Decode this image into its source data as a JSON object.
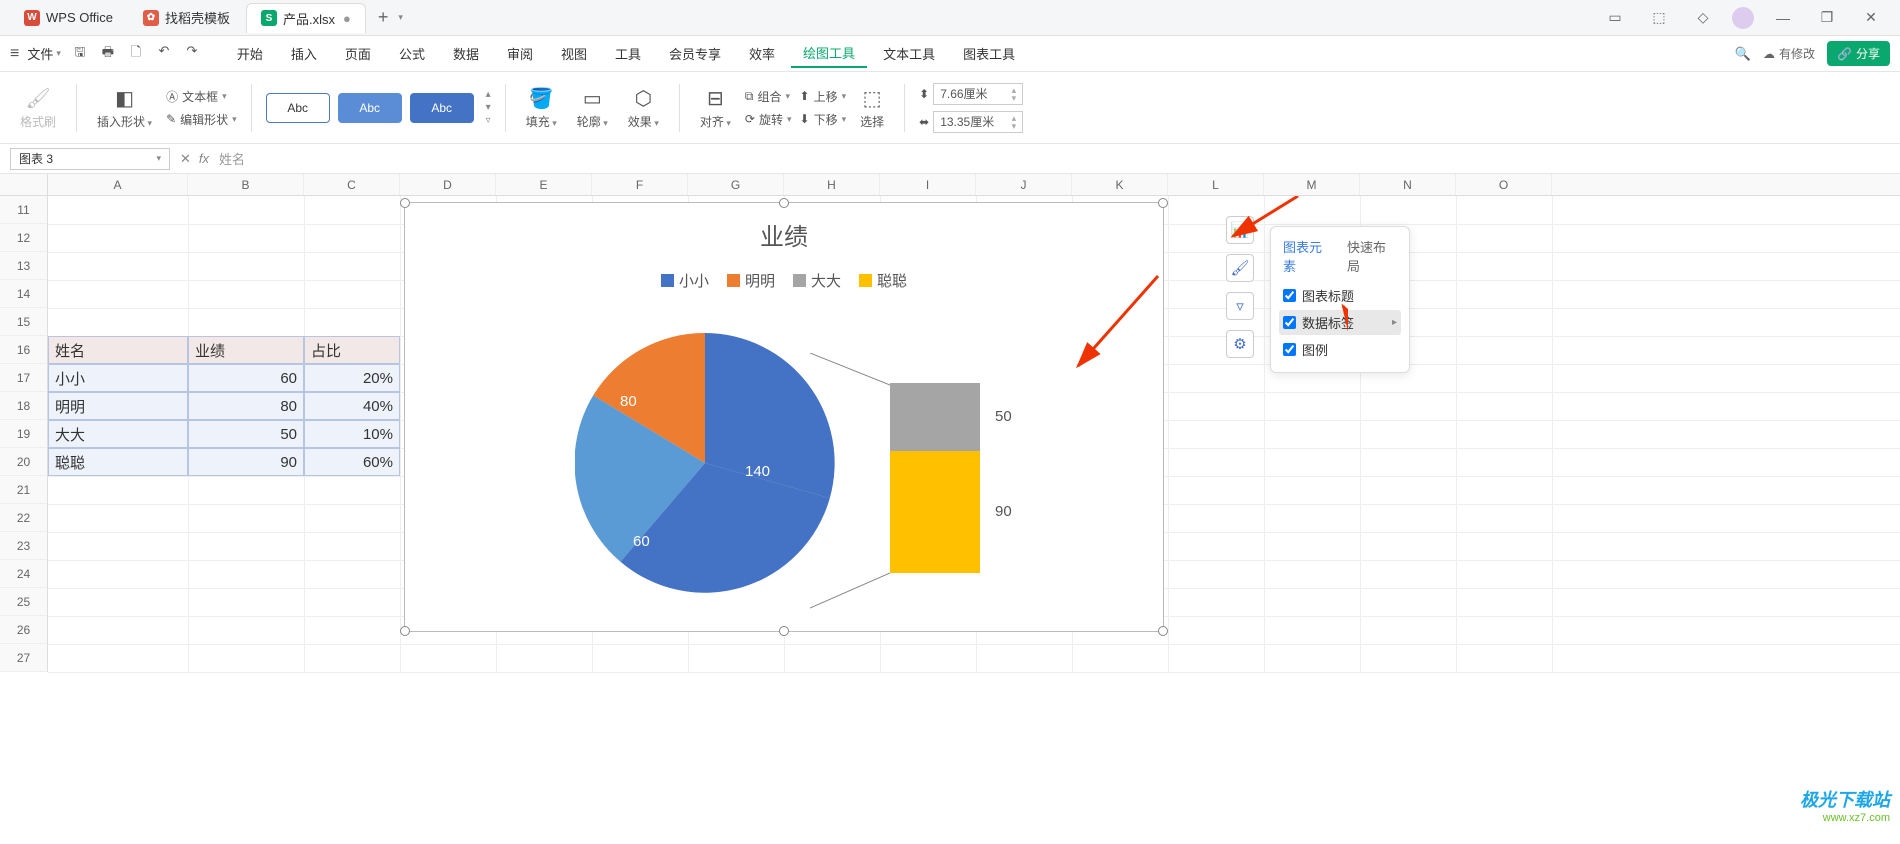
{
  "title": {
    "app": "WPS Office",
    "template": "找稻壳模板",
    "doc": "产品.xlsx"
  },
  "menu": {
    "file": "文件",
    "items": [
      "开始",
      "插入",
      "页面",
      "公式",
      "数据",
      "审阅",
      "视图",
      "工具",
      "会员专享",
      "效率",
      "绘图工具",
      "文本工具",
      "图表工具"
    ],
    "active": "绘图工具",
    "modify": "有修改",
    "share": "分享"
  },
  "ribbon": {
    "format_brush": "格式刷",
    "insert_shape": "插入形状",
    "textbox": "文本框",
    "edit_shape": "编辑形状",
    "abc": "Abc",
    "fill": "填充",
    "outline": "轮廓",
    "effect": "效果",
    "align": "对齐",
    "group": "组合",
    "rotate": "旋转",
    "up": "上移",
    "down": "下移",
    "select": "选择",
    "height": "7.66厘米",
    "width": "13.35厘米"
  },
  "formula": {
    "namebox": "图表 3",
    "value": "姓名"
  },
  "columns": [
    "A",
    "B",
    "C",
    "D",
    "E",
    "F",
    "G",
    "H",
    "I",
    "J",
    "K",
    "L",
    "M",
    "N",
    "O"
  ],
  "rows_start": 11,
  "rows_count": 17,
  "table": {
    "headers": [
      "姓名",
      "业绩",
      "占比"
    ],
    "rows": [
      [
        "小小",
        "60",
        "20%"
      ],
      [
        "明明",
        "80",
        "40%"
      ],
      [
        "大大",
        "50",
        "10%"
      ],
      [
        "聪聪",
        "90",
        "60%"
      ]
    ]
  },
  "chart_data": {
    "type": "pie",
    "title": "业绩",
    "categories": [
      "小小",
      "明明",
      "大大",
      "聪聪"
    ],
    "values": [
      60,
      80,
      50,
      90
    ],
    "labels": [
      "140",
      "80",
      "60",
      "50",
      "90"
    ],
    "colors": [
      "#4472c4",
      "#ed7d31",
      "#a5a5a5",
      "#ffc000"
    ]
  },
  "popup": {
    "tab1": "图表元素",
    "tab2": "快速布局",
    "opts": [
      "图表标题",
      "数据标签",
      "图例"
    ]
  },
  "watermark": {
    "line1": "极光下载站",
    "line2": "www.xz7.com"
  }
}
